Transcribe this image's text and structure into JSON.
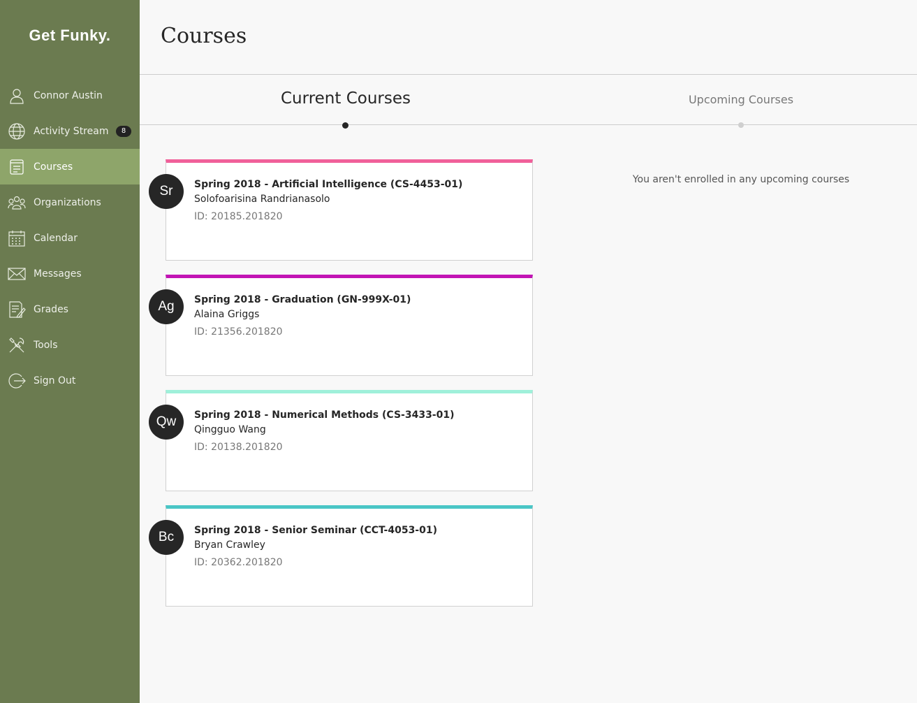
{
  "brand": "Get Funky.",
  "sidebar": {
    "items": [
      {
        "label": "Connor Austin",
        "icon": "user-icon"
      },
      {
        "label": "Activity Stream",
        "icon": "globe-icon",
        "badge": "8"
      },
      {
        "label": "Courses",
        "icon": "courses-icon",
        "active": true
      },
      {
        "label": "Organizations",
        "icon": "organizations-icon"
      },
      {
        "label": "Calendar",
        "icon": "calendar-icon"
      },
      {
        "label": "Messages",
        "icon": "envelope-icon"
      },
      {
        "label": "Grades",
        "icon": "grades-icon"
      },
      {
        "label": "Tools",
        "icon": "tools-icon"
      },
      {
        "label": "Sign Out",
        "icon": "sign-out-icon"
      }
    ]
  },
  "main": {
    "title": "Courses",
    "tabs": {
      "current": "Current Courses",
      "upcoming": "Upcoming Courses"
    },
    "upcoming_empty": "You aren't enrolled in any upcoming courses",
    "courses": [
      {
        "initials": "Sr",
        "title": "Spring 2018 - Artificial Intelligence (CS-4453-01)",
        "instructor": "Solofoarisina Randrianasolo",
        "id": "ID: 20185.201820",
        "color": "#f0609a"
      },
      {
        "initials": "Ag",
        "title": "Spring 2018 - Graduation (GN-999X-01)",
        "instructor": "Alaina Griggs",
        "id": "ID: 21356.201820",
        "color": "#c214b4"
      },
      {
        "initials": "Qw",
        "title": "Spring 2018 - Numerical Methods (CS-3433-01)",
        "instructor": "Qingguo Wang",
        "id": "ID: 20138.201820",
        "color": "#9ff0da"
      },
      {
        "initials": "Bc",
        "title": "Spring 2018 - Senior Seminar (CCT-4053-01)",
        "instructor": "Bryan Crawley",
        "id": "ID: 20362.201820",
        "color": "#4ac6c6"
      }
    ]
  },
  "colors": {
    "sidebar_bg": "#6b7b50",
    "sidebar_active": "#8ea56a",
    "text_dark": "#262626"
  }
}
